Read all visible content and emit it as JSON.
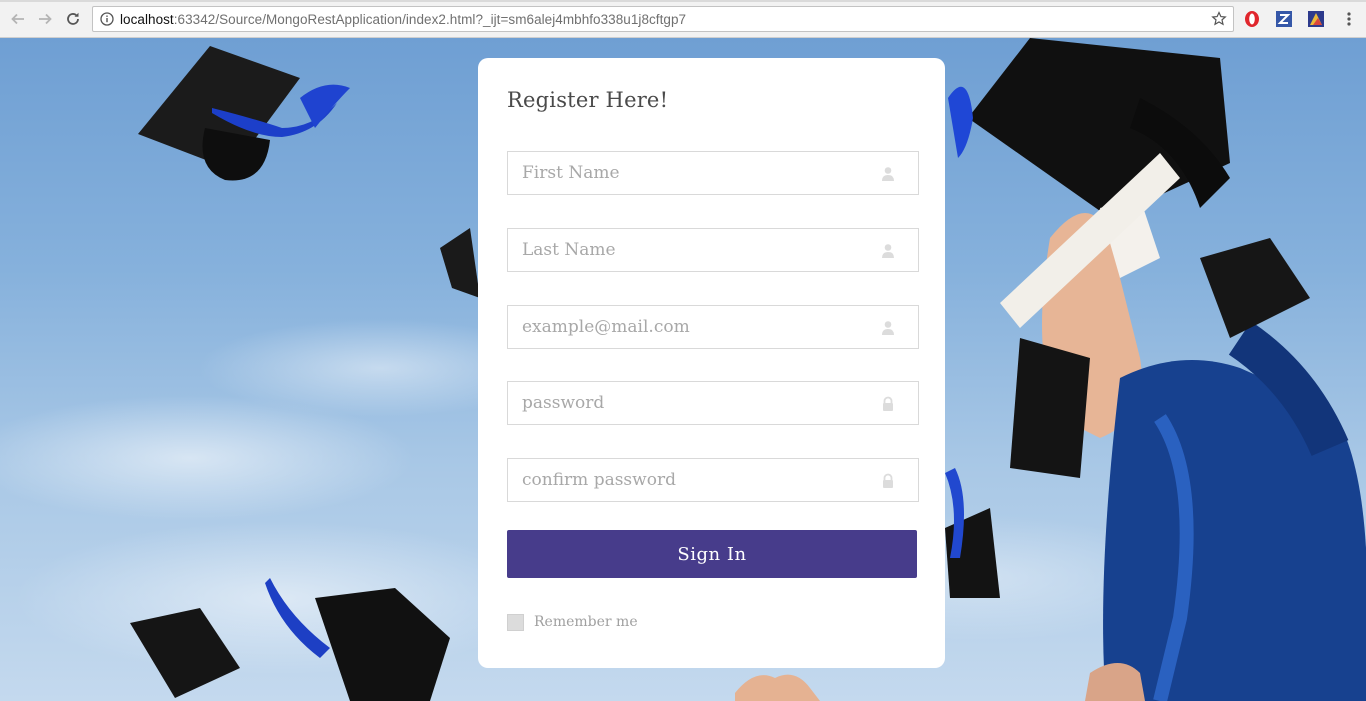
{
  "browser": {
    "url_host": "localhost",
    "url_rest": ":63342/Source/MongoRestApplication/index2.html?_ijt=sm6alej4mbhfo338u1j8cftgp7",
    "back_icon": "arrow-left-icon",
    "forward_icon": "arrow-right-icon",
    "reload_icon": "reload-icon",
    "info_icon": "info-icon",
    "bookmark_icon": "star-icon",
    "extensions": [
      "opera-icon",
      "z-extension-icon",
      "evernote-like-extension-icon"
    ],
    "menu_icon": "kebab-menu-icon"
  },
  "form": {
    "title": "Register Here!",
    "fields": [
      {
        "placeholder": "First Name",
        "icon": "user-icon"
      },
      {
        "placeholder": "Last Name",
        "icon": "user-icon"
      },
      {
        "placeholder": "example@mail.com",
        "icon": "user-icon"
      },
      {
        "placeholder": "password",
        "icon": "lock-icon"
      },
      {
        "placeholder": "confirm password",
        "icon": "lock-icon"
      }
    ],
    "submit_label": "Sign In",
    "remember_label": "Remember me"
  },
  "colors": {
    "button": "#473c8b",
    "card": "#ffffff",
    "sky": "#86b1dc"
  }
}
